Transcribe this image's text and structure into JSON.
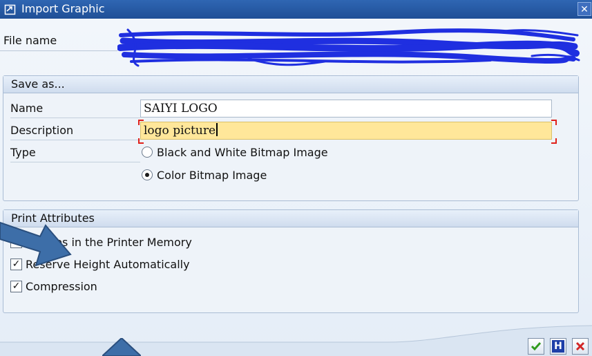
{
  "window": {
    "title": "Import Graphic",
    "close_glyph": "✕"
  },
  "file": {
    "label": "File name"
  },
  "save_as": {
    "title": "Save as...",
    "name_label": "Name",
    "name_value": "SAIYI LOGO",
    "description_label": "Description",
    "description_value": "logo picture",
    "type_label": "Type",
    "types": [
      {
        "label": "Black and White Bitmap Image",
        "selected": false
      },
      {
        "label": "Color Bitmap Image",
        "selected": true
      }
    ]
  },
  "print_attributes": {
    "title": "Print Attributes",
    "options": [
      {
        "label": "Resides in the Printer Memory",
        "checked": false
      },
      {
        "label": "Reserve Height Automatically",
        "checked": true
      },
      {
        "label": "Compression",
        "checked": true
      }
    ]
  },
  "buttons": {
    "continue_icon": "green-checkmark-icon",
    "help_label": "H",
    "cancel_icon": "red-x-icon"
  },
  "colors": {
    "title_bar": "#2f66b3",
    "active_field": "#ffe79a",
    "overlay_arrow": "#3d6ea8",
    "scribble": "#1f2fe0"
  }
}
